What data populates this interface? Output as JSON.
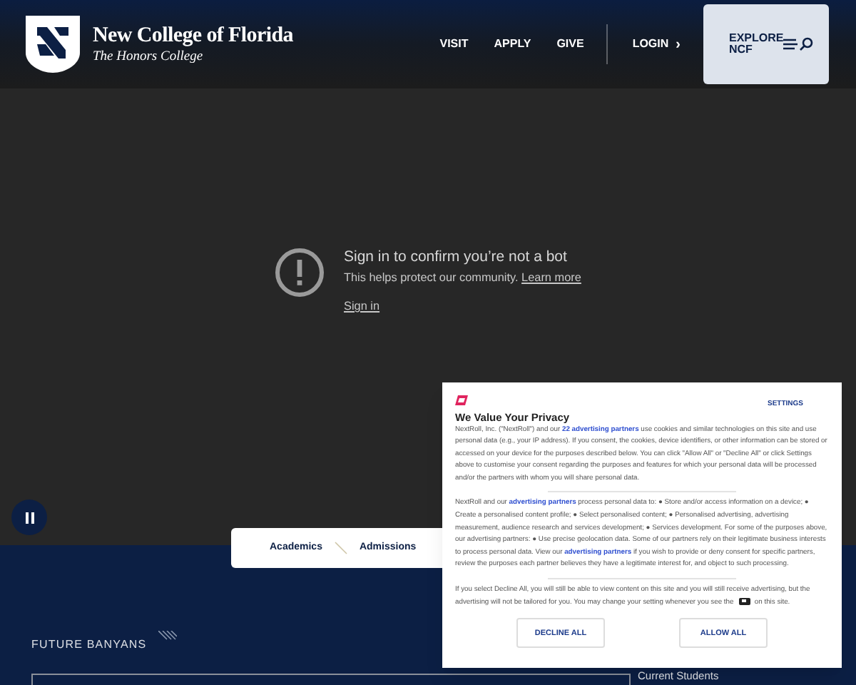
{
  "header": {
    "title": "New College of Florida",
    "subtitle": "The Honors College",
    "nav": [
      {
        "label": "VISIT"
      },
      {
        "label": "APPLY"
      },
      {
        "label": "GIVE"
      }
    ],
    "login": "LOGIN",
    "login_chevron": "›",
    "explore": "EXPLORE NCF"
  },
  "video_notice": {
    "title": "Sign in to confirm you’re not a bot",
    "text": "This helps protect our community.",
    "link": "Learn more",
    "sign_in": "Sign in"
  },
  "section_tabs": [
    {
      "label": "Academics"
    },
    {
      "label": "Admissions"
    }
  ],
  "section": {
    "heading": "FUTURE BANYANS",
    "side_link": "Current Students"
  },
  "privacy_dialog": {
    "settings": "SETTINGS",
    "title": "We Value Your Privacy",
    "paragraphs": [
      {
        "parts": [
          {
            "kind": "text",
            "text": "NextRoll, Inc. (\"NextRoll\") and our "
          },
          {
            "kind": "link",
            "text": "22 advertising partners"
          },
          {
            "kind": "text",
            "text": " use cookies and similar technologies on this site and use personal data (e.g., your IP address). If you consent, the cookies, device identifiers, or other information can be stored or accessed on your device for the purposes described below. You can click \"Allow All\" or \"Decline All\" or click Settings above to customise your consent regarding the purposes and features for which your personal data will be processed and/or the partners with whom you will share personal data."
          }
        ]
      },
      {
        "parts": [
          {
            "kind": "text",
            "text": "NextRoll and our "
          },
          {
            "kind": "link",
            "text": "advertising partners"
          },
          {
            "kind": "text",
            "text": " process personal data to: ● Store and/or access information on a device; ● Create a personalised content profile; ● Select personalised content; ● Personalised advertising, advertising measurement, audience research and services development; ● Services development. For some of the purposes above, our advertising partners: ● Use precise geolocation data. Some of our partners rely on their legitimate business interests to process personal data. View our "
          },
          {
            "kind": "link",
            "text": "advertising partners"
          },
          {
            "kind": "text",
            "text": " if you wish to provide or deny consent for specific partners, review the purposes each partner believes they have a legitimate interest for, and object to such processing."
          }
        ]
      },
      {
        "parts": [
          {
            "kind": "text",
            "text": "If you select Decline All, you will still be able to view content on this site and you will still receive advertising, but the advertising will not be tailored for you. You may change your setting whenever you see the "
          },
          {
            "kind": "icon"
          },
          {
            "kind": "text",
            "text": " on this site."
          }
        ]
      }
    ],
    "buttons": [
      {
        "label": "DECLINE ALL"
      },
      {
        "label": "ALLOW ALL"
      }
    ]
  }
}
